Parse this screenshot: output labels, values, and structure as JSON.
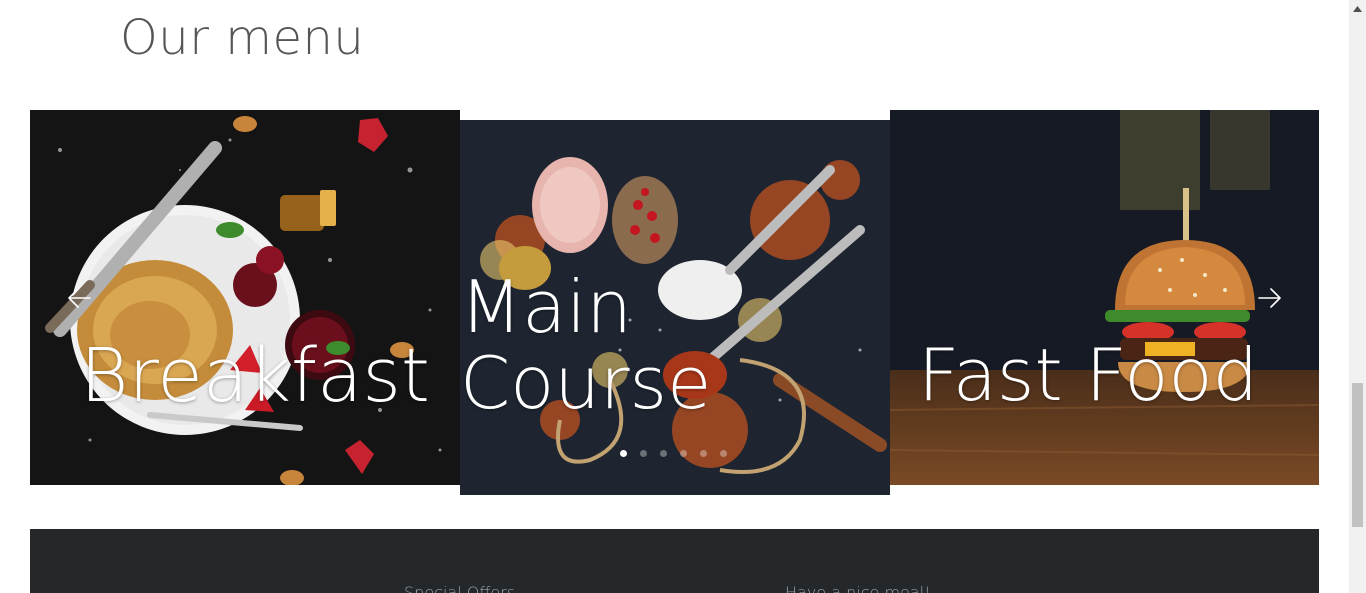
{
  "section": {
    "title": "Our menu"
  },
  "carousel": {
    "slides": [
      {
        "label": "Breakfast"
      },
      {
        "label": "Main\nCourse"
      },
      {
        "label": "Fast Food"
      }
    ],
    "prev_icon": "arrow-left-icon",
    "next_icon": "arrow-right-icon",
    "dot_count": 6,
    "active_dot": 1
  },
  "footer": {
    "col1_title": "Special Offers",
    "col2_title": "Have a nice meal!"
  },
  "colors": {
    "footer_bg": "#24282b",
    "title_text": "#555555",
    "label_text": "#ffffff"
  }
}
